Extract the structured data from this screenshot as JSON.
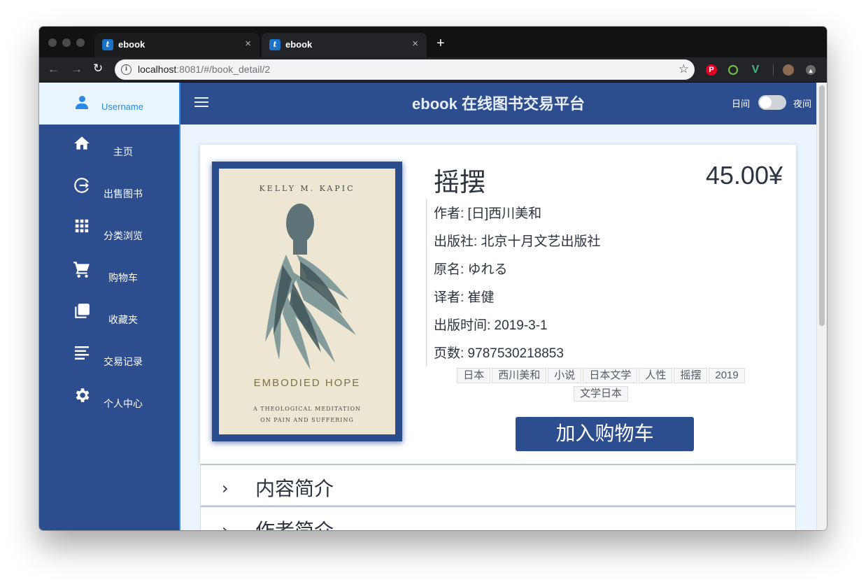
{
  "browser": {
    "tabs": [
      {
        "title": "ebook",
        "favicon": "ebook-favicon",
        "close": "×"
      },
      {
        "title": "ebook",
        "favicon": "ebook-favicon",
        "close": "×"
      }
    ],
    "new_tab": "+",
    "url_host": "localhost",
    "url_path": ":8081/#/book_detail/2",
    "extensions": [
      "pinterest-icon",
      "refresh-green-icon",
      "vue-icon",
      "avatar-icon",
      "upload-icon"
    ]
  },
  "sidebar": {
    "username": "Username",
    "items": [
      {
        "label": "主页",
        "icon": "home-icon"
      },
      {
        "label": "出售图书",
        "icon": "exit-icon"
      },
      {
        "label": "分类浏览",
        "icon": "apps-icon"
      },
      {
        "label": "购物车",
        "icon": "cart-icon"
      },
      {
        "label": "收藏夹",
        "icon": "collection-icon"
      },
      {
        "label": "交易记录",
        "icon": "list-icon"
      },
      {
        "label": "个人中心",
        "icon": "gear-icon"
      }
    ]
  },
  "header": {
    "title": "ebook 在线图书交易平台",
    "day_label": "日间",
    "night_label": "夜间",
    "night_mode": false
  },
  "book": {
    "title": "摇摆",
    "price": "45.00¥",
    "author": "作者: [日]西川美和",
    "publisher": "出版社: 北京十月文艺出版社",
    "original_name": "原名: ゆれる",
    "translator": "译者: 崔健",
    "publish_date": "出版时间: 2019-3-1",
    "pages": "页数: 9787530218853",
    "tags": [
      "日本",
      "西川美和",
      "小说",
      "日本文学",
      "人性",
      "摇摆",
      "2019",
      "文学日本"
    ],
    "add_to_cart": "加入购物车",
    "cover": {
      "author": "KELLY M. KAPIC",
      "title": "EMBODIED HOPE",
      "subtitle_line1": "A THEOLOGICAL MEDITATION",
      "subtitle_line2": "ON PAIN AND SUFFERING"
    }
  },
  "sections": [
    {
      "label": "内容简介"
    },
    {
      "label": "作者简介"
    }
  ],
  "colors": {
    "primary": "#2c4d8e",
    "accent": "#2a8ae6",
    "content_bg": "#ebf4fc"
  }
}
